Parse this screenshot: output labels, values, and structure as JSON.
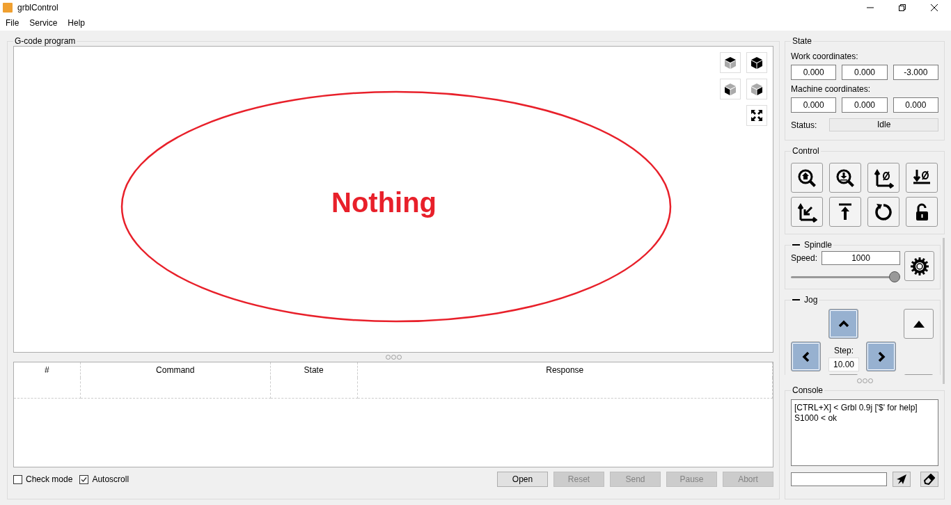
{
  "window": {
    "title": "grblControl"
  },
  "menu": [
    "File",
    "Service",
    "Help"
  ],
  "program": {
    "title": "G-code program",
    "viewport_message": "Nothing",
    "table": {
      "columns": [
        "#",
        "Command",
        "State",
        "Response"
      ]
    },
    "options": [
      {
        "label": "Check mode",
        "checked": false
      },
      {
        "label": "Autoscroll",
        "checked": true
      }
    ],
    "buttons": [
      {
        "label": "Open",
        "disabled": false
      },
      {
        "label": "Reset",
        "disabled": true
      },
      {
        "label": "Send",
        "disabled": true
      },
      {
        "label": "Pause",
        "disabled": true
      },
      {
        "label": "Abort",
        "disabled": true
      }
    ]
  },
  "state": {
    "title": "State",
    "work_label": "Work coordinates:",
    "work": [
      "0.000",
      "0.000",
      "-3.000"
    ],
    "machine_label": "Machine coordinates:",
    "machine": [
      "0.000",
      "0.000",
      "0.000"
    ],
    "status_label": "Status:",
    "status": "Idle"
  },
  "control": {
    "title": "Control"
  },
  "spindle": {
    "title": "Spindle",
    "expanded": true,
    "speed_label": "Speed:",
    "speed": "1000",
    "level": 1.0
  },
  "jog": {
    "title": "Jog",
    "expanded": true,
    "step_label": "Step:",
    "step": "10.00"
  },
  "console": {
    "title": "Console",
    "lines": [
      "[CTRL+X] < Grbl 0.9j ['$' for help]",
      "S1000 < ok"
    ]
  }
}
